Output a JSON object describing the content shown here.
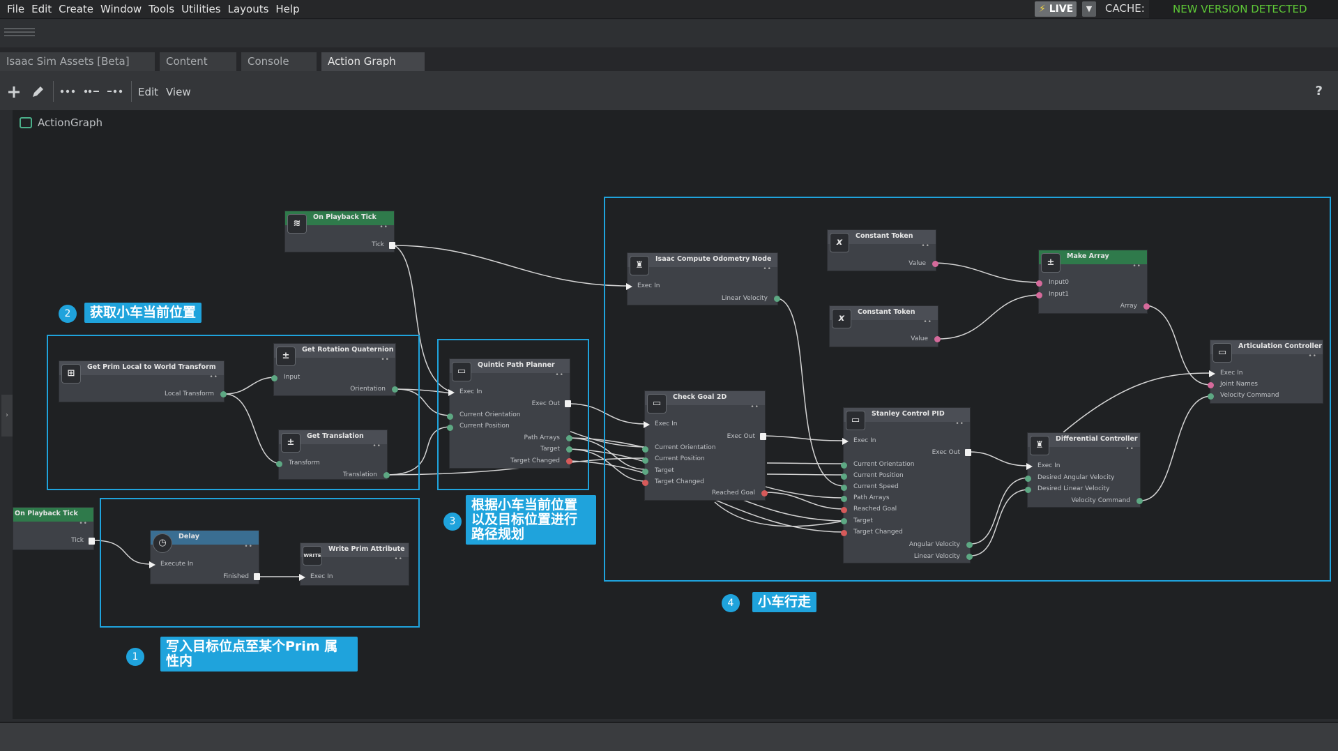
{
  "menu": [
    "File",
    "Edit",
    "Create",
    "Window",
    "Tools",
    "Utilities",
    "Layouts",
    "Help"
  ],
  "live": {
    "label": "LIVE",
    "bolt": "⚡"
  },
  "cache": {
    "label": "CACHE:",
    "status": "NEW VERSION DETECTED",
    "status_color": "#5ec837"
  },
  "tabs": [
    "Isaac Sim Assets [Beta]",
    "Content",
    "Console",
    "Action Graph"
  ],
  "active_tab": "Action Graph",
  "toolbar": {
    "edit": "Edit",
    "view": "View",
    "help": "?"
  },
  "graph_title": "ActionGraph",
  "colors": {
    "annotation": "#1fa3dc",
    "green_header": "#2f7a4b",
    "blue_header": "#3a6e92",
    "wire": "#d0d0d0"
  },
  "nodes": {
    "tick1": {
      "title": "On Playback Tick",
      "ports": {
        "tick": "Tick"
      }
    },
    "tick2": {
      "title": "On Playback Tick",
      "ports": {
        "tick": "Tick"
      }
    },
    "primlocal": {
      "title": "Get Prim Local to World Transform",
      "ports": {
        "out": "Local Transform"
      }
    },
    "rotq": {
      "title": "Get Rotation Quaternion",
      "ports": {
        "in": "Input",
        "out": "Orientation"
      }
    },
    "gettrans": {
      "title": "Get Translation",
      "ports": {
        "in": "Transform",
        "out": "Translation"
      }
    },
    "quintic": {
      "title": "Quintic Path Planner",
      "ports": {
        "exec_in": "Exec In",
        "exec_out": "Exec Out",
        "cur_ori": "Current Orientation",
        "cur_pos": "Current Position",
        "path": "Path Arrays",
        "target": "Target",
        "tchanged": "Target Changed"
      }
    },
    "delay": {
      "title": "Delay",
      "ports": {
        "exec_in": "Execute In",
        "finished": "Finished"
      }
    },
    "write": {
      "title": "Write Prim Attribute",
      "icon": "WRITE",
      "ports": {
        "exec_in": "Exec In"
      }
    },
    "odom": {
      "title": "Isaac Compute Odometry Node",
      "ports": {
        "exec_in": "Exec In",
        "lin_vel": "Linear Velocity"
      }
    },
    "checkgoal": {
      "title": "Check Goal 2D",
      "ports": {
        "exec_in": "Exec In",
        "exec_out": "Exec Out",
        "cur_ori": "Current Orientation",
        "cur_pos": "Current Position",
        "target": "Target",
        "tchanged": "Target Changed",
        "reached": "Reached Goal"
      }
    },
    "const1": {
      "title": "Constant Token",
      "ports": {
        "value": "Value"
      }
    },
    "const2": {
      "title": "Constant Token",
      "ports": {
        "value": "Value"
      }
    },
    "makearr": {
      "title": "Make Array",
      "ports": {
        "in0": "Input0",
        "in1": "Input1",
        "array": "Array"
      }
    },
    "stanley": {
      "title": "Stanley Control PID",
      "ports": {
        "exec_in": "Exec In",
        "exec_out": "Exec Out",
        "cur_ori": "Current Orientation",
        "cur_pos": "Current Position",
        "cur_speed": "Current Speed",
        "path": "Path Arrays",
        "reached": "Reached Goal",
        "target": "Target",
        "tchanged": "Target Changed",
        "ang_vel": "Angular Velocity",
        "lin_vel": "Linear Velocity"
      }
    },
    "diffctrl": {
      "title": "Differential Controller",
      "ports": {
        "exec_in": "Exec In",
        "des_ang": "Desired Angular Velocity",
        "des_lin": "Desired Linear Velocity",
        "vel_cmd": "Velocity Command"
      }
    },
    "artic": {
      "title": "Articulation Controller",
      "ports": {
        "exec_in": "Exec In",
        "joint_names": "Joint Names",
        "vel_cmd": "Velocity Command"
      }
    }
  },
  "annotations": [
    {
      "num": "1",
      "text": "写入目标位点至某个Prim 属\n性内"
    },
    {
      "num": "2",
      "text": "获取小车当前位置"
    },
    {
      "num": "3",
      "text": "根据小车当前位置\n以及目标位置进行\n路径规划"
    },
    {
      "num": "4",
      "text": "小车行走"
    }
  ]
}
